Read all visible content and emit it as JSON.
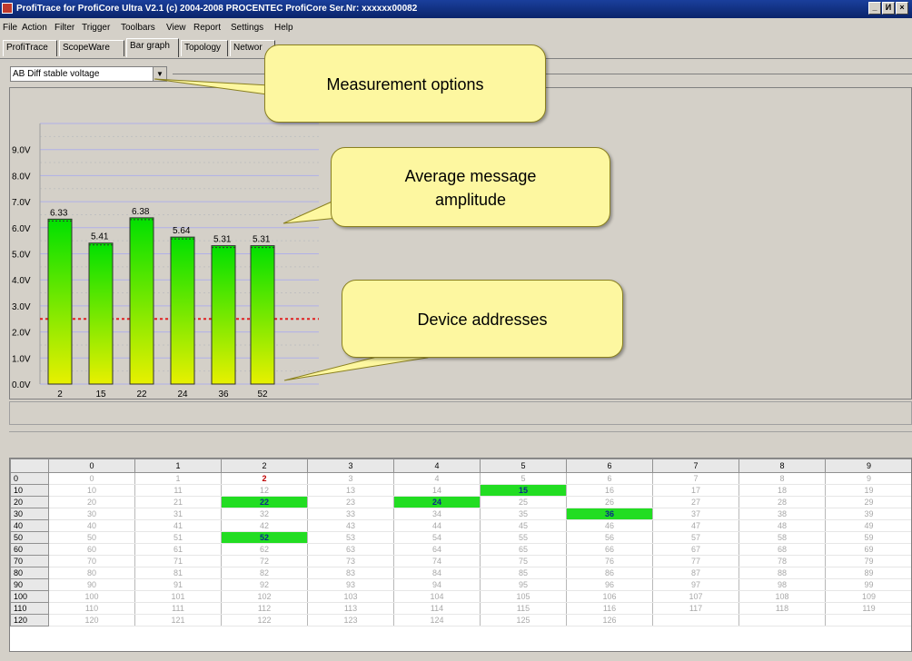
{
  "window": {
    "title": "ProfiTrace for ProfiCore Ultra V2.1 (c) 2004-2008 PROCENTEC  ProfiCore Ser.Nr: xxxxxx00082",
    "controls": [
      "_",
      "И",
      "×"
    ]
  },
  "menu": [
    "File",
    "Action",
    "Filter",
    "Trigger",
    "Toolbars",
    "View",
    "Report",
    "Settings",
    "Help"
  ],
  "tabs": [
    {
      "label": "ProfiTrace",
      "active": false
    },
    {
      "label": "ScopeWare",
      "active": false
    },
    {
      "label": "Bar graph",
      "active": true
    },
    {
      "label": "Topology",
      "active": false
    },
    {
      "label": "Networ",
      "active": false
    }
  ],
  "measurement": {
    "selected": "AB Diff stable voltage"
  },
  "callouts": {
    "measurement_options": "Measurement options",
    "average_amplitude": "Average message amplitude",
    "device_addresses": "Device addresses"
  },
  "chart_data": {
    "type": "bar",
    "categories": [
      "2",
      "15",
      "22",
      "24",
      "36",
      "52"
    ],
    "values": [
      6.33,
      5.41,
      6.38,
      5.64,
      5.31,
      5.31
    ],
    "value_labels": [
      "6.33",
      "5.41",
      "6.38",
      "5.64",
      "5.31",
      "5.31"
    ],
    "y_ticks": [
      "0.0V",
      "1.0V",
      "2.0V",
      "3.0V",
      "4.0V",
      "5.0V",
      "6.0V",
      "7.0V",
      "8.0V",
      "9.0V"
    ],
    "ylim": [
      0,
      10
    ],
    "threshold": 2.5,
    "colors": {
      "bar_top": "#00e000",
      "bar_bottom": "#e8f000",
      "threshold": "#e02020",
      "grid": "#b0b0e8"
    }
  },
  "address_table": {
    "col_headers": [
      "0",
      "1",
      "2",
      "3",
      "4",
      "5",
      "6",
      "7",
      "8",
      "9"
    ],
    "row_headers": [
      "0",
      "10",
      "20",
      "30",
      "40",
      "50",
      "60",
      "70",
      "80",
      "90",
      "100",
      "110",
      "120"
    ],
    "max_address": 126,
    "active_addresses": [
      15,
      22,
      24,
      36,
      52
    ],
    "master_address": 2
  }
}
